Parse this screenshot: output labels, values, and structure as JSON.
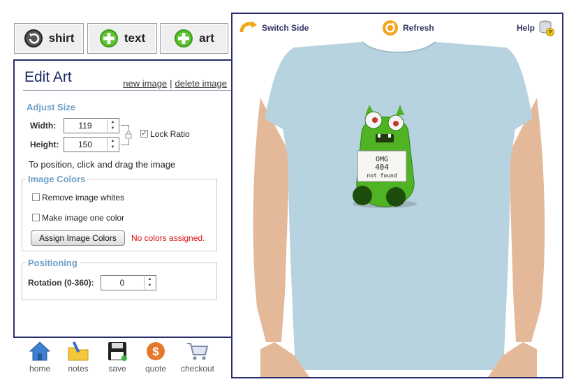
{
  "toolbar": {
    "shirt_label": "shirt",
    "text_label": "text",
    "art_label": "art"
  },
  "panel": {
    "title": "Edit Art",
    "new_image": "new image",
    "delete_image": "delete image",
    "separator": "|",
    "adjust_size": {
      "title": "Adjust Size",
      "width_label": "Width:",
      "width_value": "119",
      "height_label": "Height:",
      "height_value": "150",
      "lock_ratio_label": "Lock Ratio",
      "lock_ratio_checked": true
    },
    "position_hint": "To position, click and drag the image",
    "image_colors": {
      "title": "Image Colors",
      "remove_whites_label": "Remove image whites",
      "one_color_label": "Make image one color",
      "assign_button": "Assign Image Colors",
      "status": "No colors assigned."
    },
    "positioning": {
      "title": "Positioning",
      "rotation_label": "Rotation (0-360):",
      "rotation_value": "0"
    }
  },
  "nav": {
    "home": "home",
    "notes": "notes",
    "save": "save",
    "quote": "quote",
    "checkout": "checkout"
  },
  "preview": {
    "switch_side": "Switch Side",
    "refresh": "Refresh",
    "help": "Help",
    "sign_line1": "OMG",
    "sign_line2": "404",
    "sign_line3": "not found"
  },
  "colors": {
    "accent": "#2a2d6c",
    "section_title": "#6f9fc7",
    "shirt": "#b8d3e0",
    "monster": "#4fb323",
    "error": "#dd1111"
  },
  "icons": {
    "shirt": "rotate-arrow-icon",
    "text": "green-plus-icon",
    "art": "green-plus-icon",
    "home": "house-icon",
    "notes": "folder-pen-icon",
    "save": "floppy-disk-icon",
    "quote": "dollar-coin-icon",
    "checkout": "shopping-cart-icon"
  }
}
